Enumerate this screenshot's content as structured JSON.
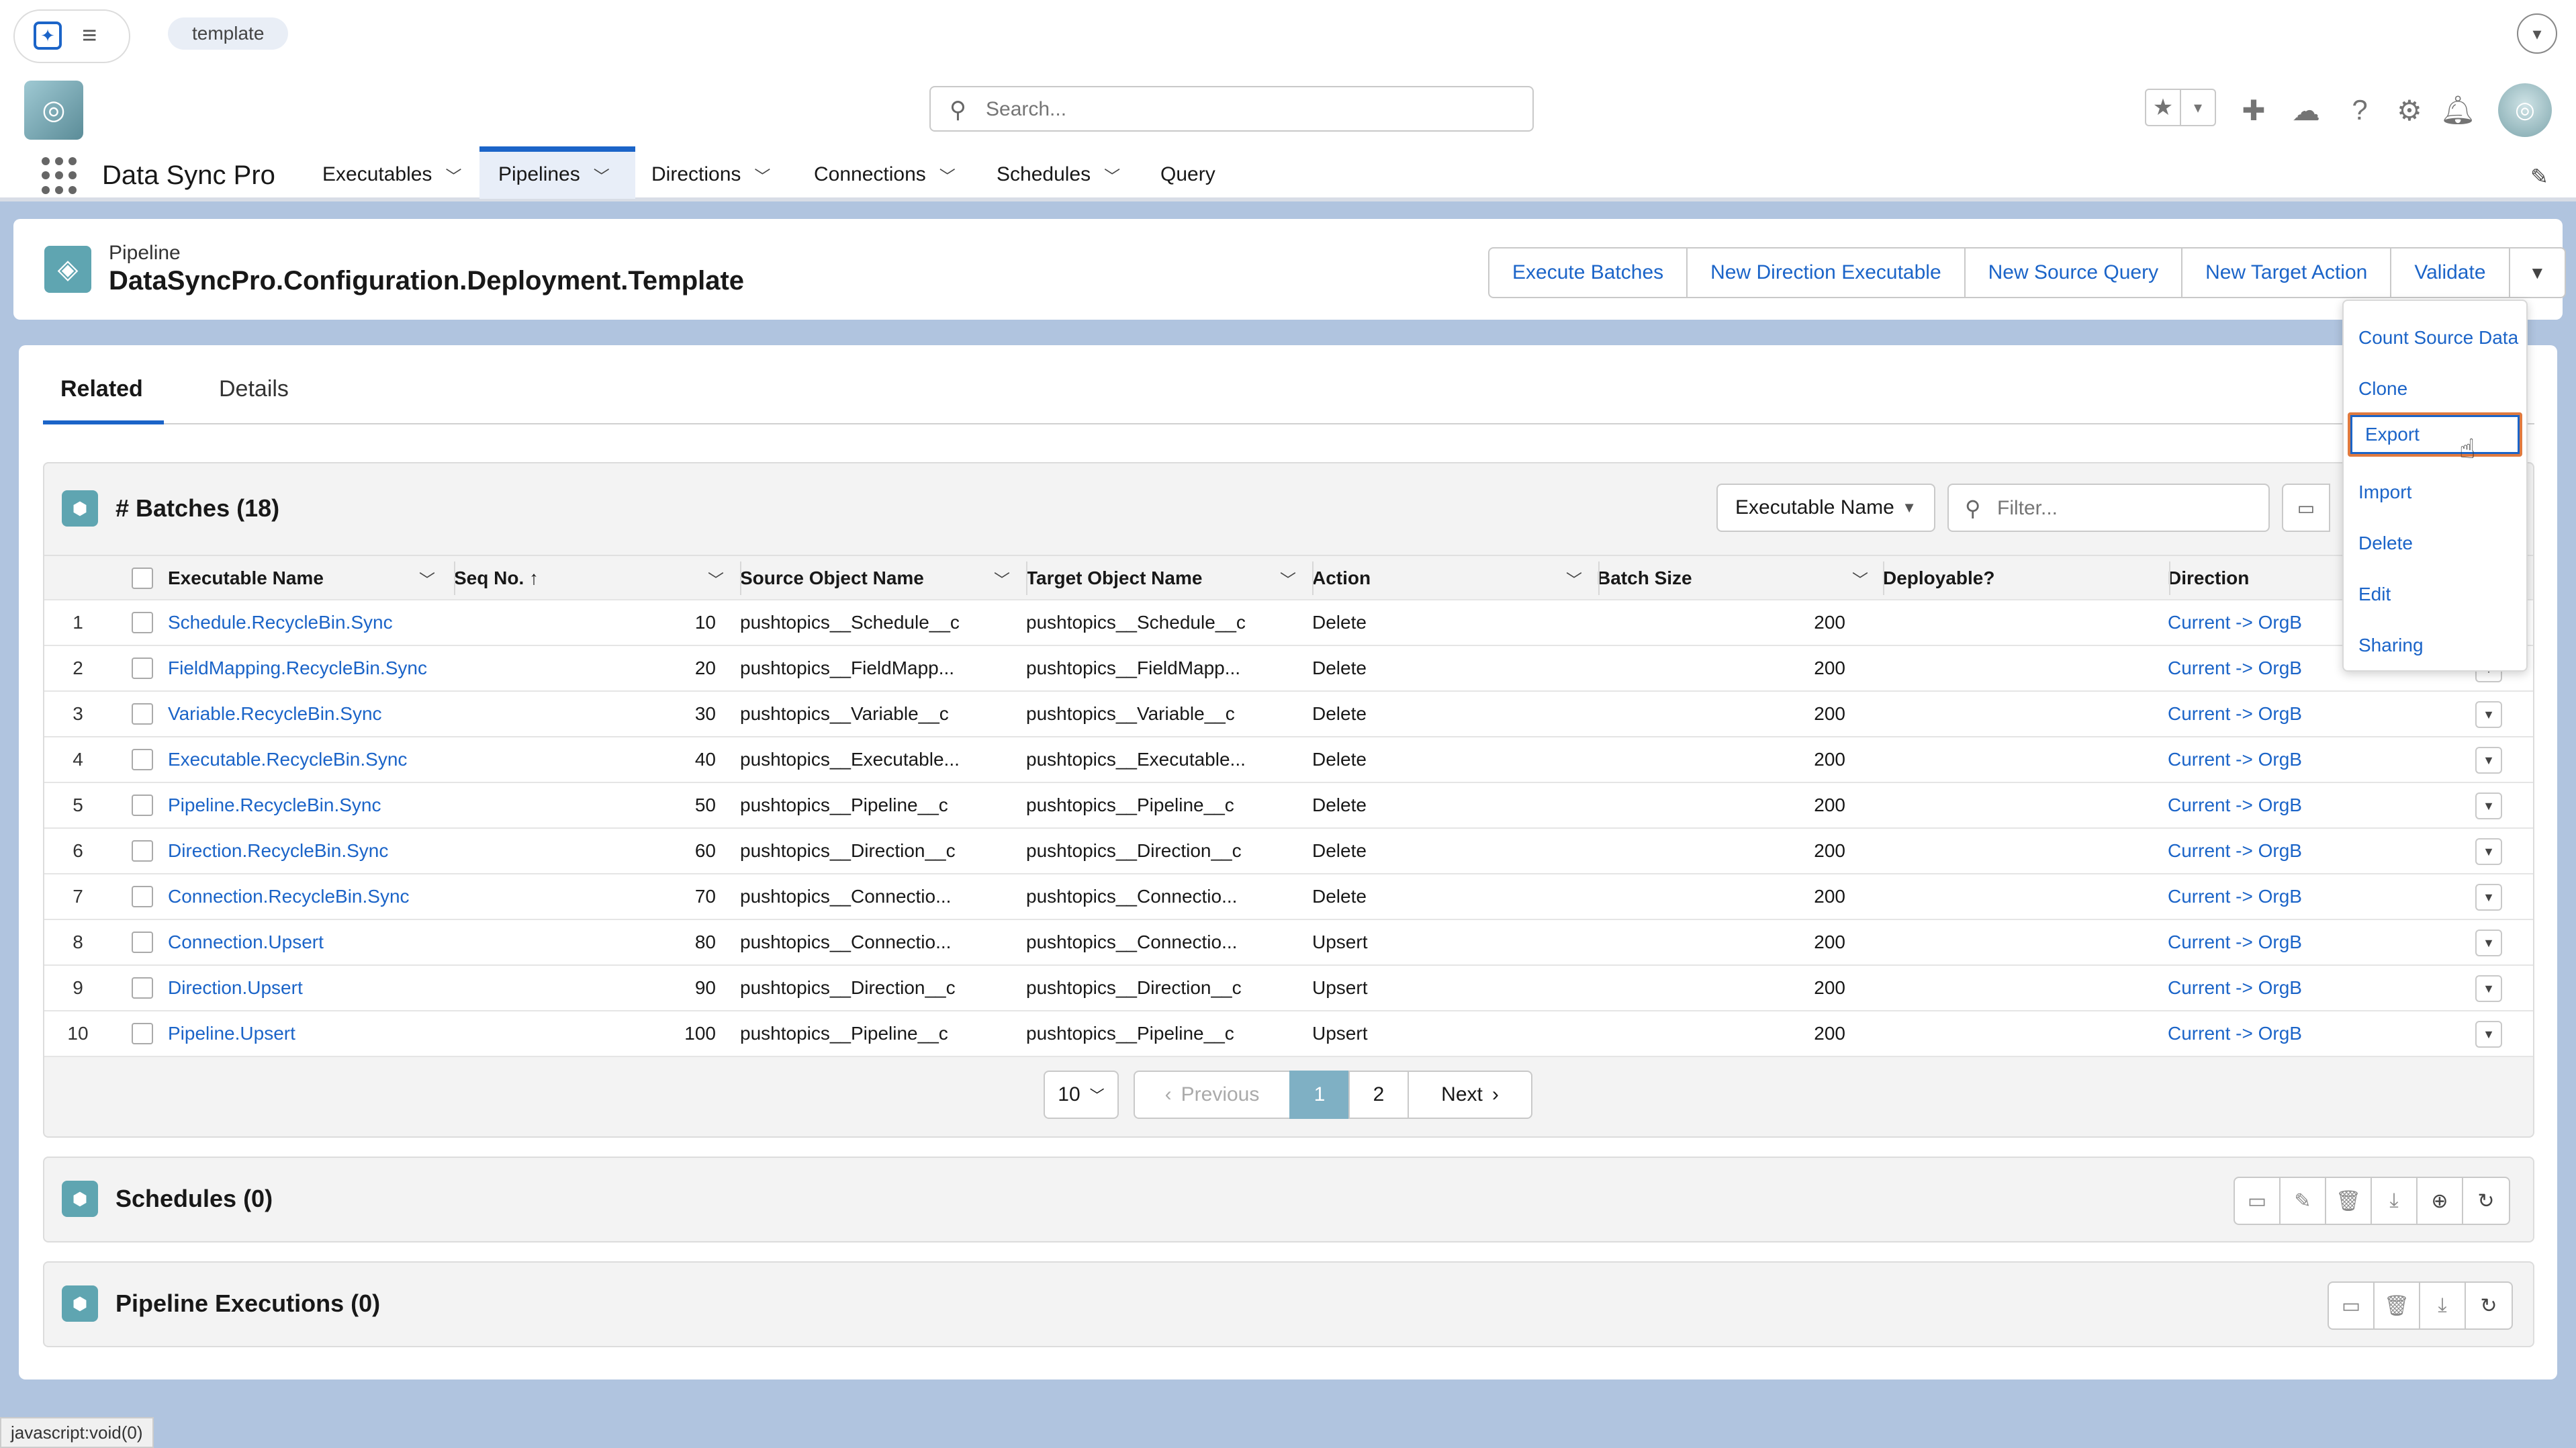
{
  "top": {
    "template_tag": "template"
  },
  "header": {
    "search_placeholder": "Search...",
    "app_name": "Data Sync Pro",
    "nav": [
      {
        "label": "Executables"
      },
      {
        "label": "Pipelines"
      },
      {
        "label": "Directions"
      },
      {
        "label": "Connections"
      },
      {
        "label": "Schedules"
      },
      {
        "label": "Query"
      }
    ]
  },
  "record": {
    "type": "Pipeline",
    "title": "DataSyncPro.Configuration.Deployment.Template",
    "actions": [
      "Execute Batches",
      "New Direction Executable",
      "New Source Query",
      "New Target Action",
      "Validate"
    ]
  },
  "tabs": {
    "related": "Related",
    "details": "Details"
  },
  "batches": {
    "title": "# Batches (18)",
    "column_select": "Executable Name",
    "filter_placeholder": "Filter...",
    "columns": [
      "Executable Name",
      "Seq No. ↑",
      "Source Object Name",
      "Target Object Name",
      "Action",
      "Batch Size",
      "Deployable?",
      "Direction"
    ],
    "rows": [
      {
        "n": "1",
        "name": "Schedule.RecycleBin.Sync",
        "seq": "10",
        "src": "pushtopics__Schedule__c",
        "tgt": "pushtopics__Schedule__c",
        "action": "Delete",
        "size": "200",
        "deploy": "",
        "dir": "Current -> OrgB"
      },
      {
        "n": "2",
        "name": "FieldMapping.RecycleBin.Sync",
        "seq": "20",
        "src": "pushtopics__FieldMapp...",
        "tgt": "pushtopics__FieldMapp...",
        "action": "Delete",
        "size": "200",
        "deploy": "",
        "dir": "Current -> OrgB"
      },
      {
        "n": "3",
        "name": "Variable.RecycleBin.Sync",
        "seq": "30",
        "src": "pushtopics__Variable__c",
        "tgt": "pushtopics__Variable__c",
        "action": "Delete",
        "size": "200",
        "deploy": "",
        "dir": "Current -> OrgB"
      },
      {
        "n": "4",
        "name": "Executable.RecycleBin.Sync",
        "seq": "40",
        "src": "pushtopics__Executable...",
        "tgt": "pushtopics__Executable...",
        "action": "Delete",
        "size": "200",
        "deploy": "",
        "dir": "Current -> OrgB"
      },
      {
        "n": "5",
        "name": "Pipeline.RecycleBin.Sync",
        "seq": "50",
        "src": "pushtopics__Pipeline__c",
        "tgt": "pushtopics__Pipeline__c",
        "action": "Delete",
        "size": "200",
        "deploy": "",
        "dir": "Current -> OrgB"
      },
      {
        "n": "6",
        "name": "Direction.RecycleBin.Sync",
        "seq": "60",
        "src": "pushtopics__Direction__c",
        "tgt": "pushtopics__Direction__c",
        "action": "Delete",
        "size": "200",
        "deploy": "",
        "dir": "Current -> OrgB"
      },
      {
        "n": "7",
        "name": "Connection.RecycleBin.Sync",
        "seq": "70",
        "src": "pushtopics__Connectio...",
        "tgt": "pushtopics__Connectio...",
        "action": "Delete",
        "size": "200",
        "deploy": "",
        "dir": "Current -> OrgB"
      },
      {
        "n": "8",
        "name": "Connection.Upsert",
        "seq": "80",
        "src": "pushtopics__Connectio...",
        "tgt": "pushtopics__Connectio...",
        "action": "Upsert",
        "size": "200",
        "deploy": "",
        "dir": "Current -> OrgB"
      },
      {
        "n": "9",
        "name": "Direction.Upsert",
        "seq": "90",
        "src": "pushtopics__Direction__c",
        "tgt": "pushtopics__Direction__c",
        "action": "Upsert",
        "size": "200",
        "deploy": "",
        "dir": "Current -> OrgB"
      },
      {
        "n": "10",
        "name": "Pipeline.Upsert",
        "seq": "100",
        "src": "pushtopics__Pipeline__c",
        "tgt": "pushtopics__Pipeline__c",
        "action": "Upsert",
        "size": "200",
        "deploy": "",
        "dir": "Current -> OrgB"
      }
    ]
  },
  "pagination": {
    "page_size": "10",
    "previous": "Previous",
    "pages": [
      "1",
      "2"
    ],
    "next": "Next"
  },
  "schedules": {
    "title": "Schedules (0)"
  },
  "executions": {
    "title": "Pipeline Executions (0)"
  },
  "menu": [
    "Count Source Data",
    "Clone",
    "Export",
    "Import",
    "Delete",
    "Edit",
    "Sharing"
  ],
  "status_url": "javascript:void(0)",
  "colors": {
    "brand_blue": "#1b64c8",
    "highlight_orange": "#e07a3f",
    "teal_icon": "#5fa5b1",
    "page_bg": "#b0c4df"
  }
}
